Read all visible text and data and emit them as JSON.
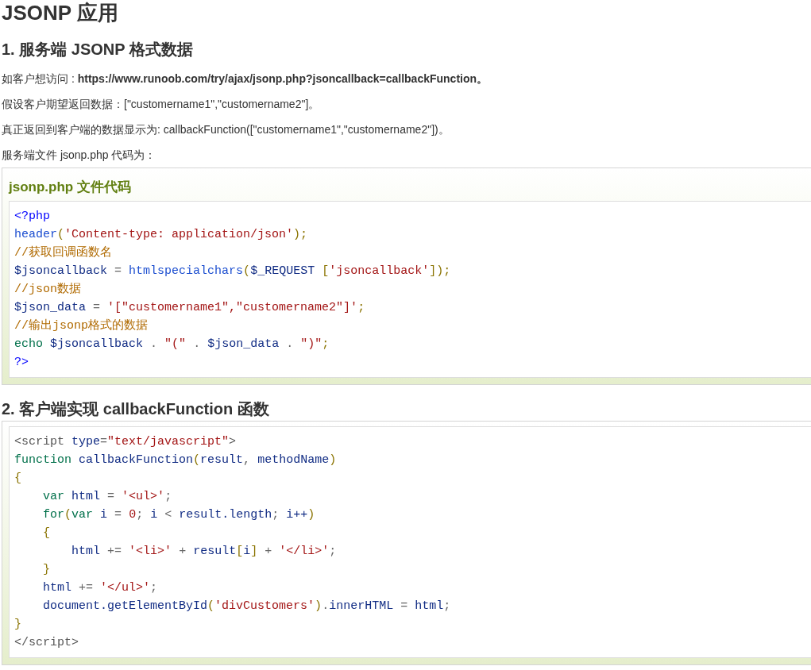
{
  "title": "JSONP 应用",
  "sections": [
    {
      "heading": "1. 服务端 JSONP 格式数据",
      "paragraphs": [
        "如客户想访问 : **https://www.runoob.com/try/ajax/jsonp.php?jsoncallback=callbackFunction。**",
        "假设客户期望返回数据：[\"customername1\",\"customername2\"]。",
        "真正返回到客户端的数据显示为: callbackFunction([\"customername1\",\"customername2\"])。",
        "服务端文件 jsonp.php 代码为："
      ],
      "example": {
        "title": "jsonp.php 文件代码",
        "kind": "php",
        "lines": [
          "<?php",
          "header('Content-type: application/json');",
          "//获取回调函数名",
          "$jsoncallback = htmlspecialchars($_REQUEST ['jsoncallback']);",
          "//json数据",
          "$json_data = '[\"customername1\",\"customername2\"]';",
          "//输出jsonp格式的数据",
          "echo $jsoncallback . \"(\" . $json_data . \")\";",
          "?>"
        ]
      }
    },
    {
      "heading": "2. 客户端实现 callbackFunction 函数",
      "example": {
        "kind": "javascript",
        "lines": [
          "<script type=\"text/javascript\">",
          "function callbackFunction(result, methodName)",
          "{",
          "    var html = '<ul>';",
          "    for(var i = 0; i < result.length; i++)",
          "    {",
          "        html += '<li>' + result[i] + '</li>';",
          "    }",
          "    html += '</ul>';",
          "    document.getElementById('divCustomers').innerHTML = html;",
          "}",
          "</script>"
        ]
      }
    }
  ]
}
